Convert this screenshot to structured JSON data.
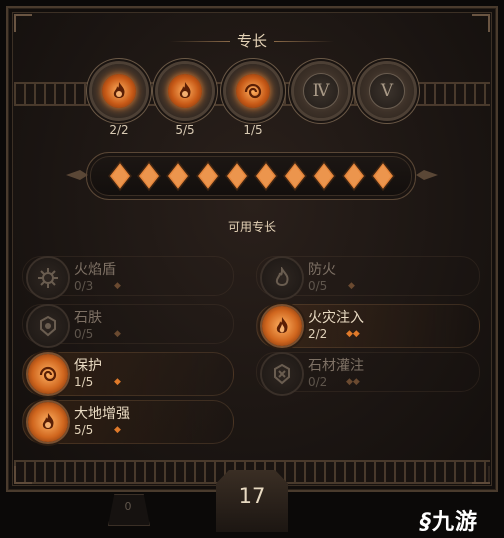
{
  "panel": {
    "title": "专长",
    "available_label": "可用专长"
  },
  "ranks": [
    {
      "symbol": "",
      "count": "2/2",
      "state": "active",
      "icon": "fire-emblem-icon"
    },
    {
      "symbol": "",
      "count": "5/5",
      "state": "active",
      "icon": "fire-emblem-icon"
    },
    {
      "symbol": "",
      "count": "1/5",
      "state": "active",
      "icon": "earth-emblem-icon"
    },
    {
      "symbol": "Ⅳ",
      "count": "",
      "state": "locked",
      "icon": "roman-four-icon"
    },
    {
      "symbol": "Ⅴ",
      "count": "",
      "state": "locked",
      "icon": "roman-five-icon"
    }
  ],
  "points": {
    "filled": 10,
    "total": 10
  },
  "skills_left": [
    {
      "name": "火焰盾",
      "level": "0/3",
      "active": false,
      "diamonds": 1
    },
    {
      "name": "石肤",
      "level": "0/5",
      "active": false,
      "diamonds": 1
    },
    {
      "name": "保护",
      "level": "1/5",
      "active": true,
      "diamonds": 1
    },
    {
      "name": "大地增强",
      "level": "5/5",
      "active": true,
      "diamonds": 1
    }
  ],
  "skills_right": [
    {
      "name": "防火",
      "level": "0/5",
      "active": false,
      "diamonds": 1
    },
    {
      "name": "火灾注入",
      "level": "2/2",
      "active": true,
      "diamonds": 2
    },
    {
      "name": "石材灌注",
      "level": "0/2",
      "active": false,
      "diamonds": 2
    }
  ],
  "footer": {
    "level": "17",
    "left_value": "0"
  },
  "watermark": "九游",
  "colors": {
    "accent_orange": "#e07a2a",
    "text_light": "#e8dac2",
    "text_dim": "#7d7064",
    "frame": "#5a4736"
  }
}
